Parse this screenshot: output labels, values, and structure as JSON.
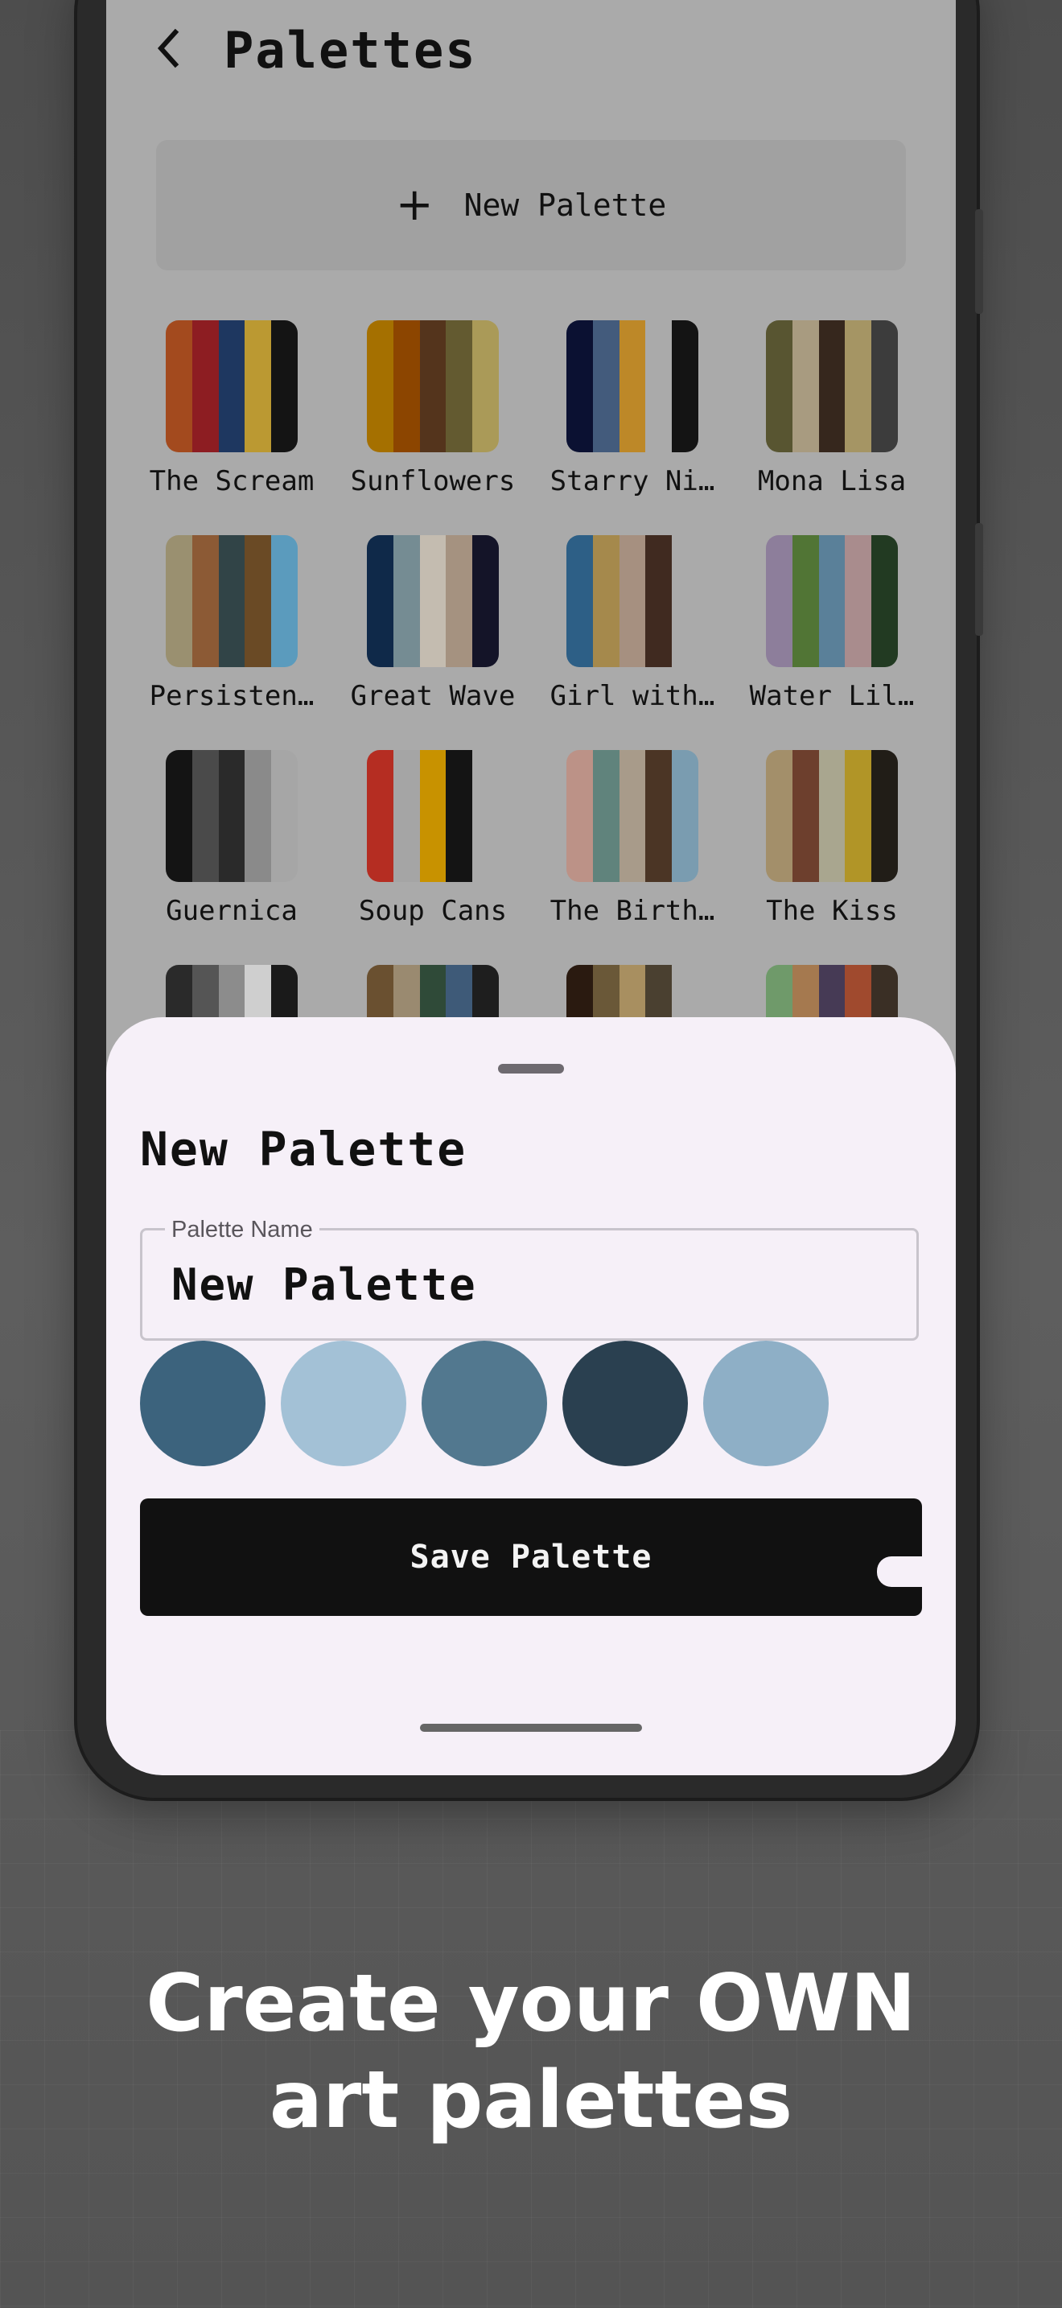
{
  "header": {
    "title": "Palettes",
    "back_icon": "arrow-back-icon"
  },
  "new_palette_button": {
    "icon": "plus-icon",
    "label": "New Palette"
  },
  "palettes": [
    {
      "name": "The Scream",
      "colors": [
        "#a34a1e",
        "#8d1d22",
        "#1e3760",
        "#bb9932",
        "#141414"
      ]
    },
    {
      "name": "Sunflowers",
      "colors": [
        "#a57000",
        "#8c4500",
        "#54341c",
        "#635a30",
        "#aa9a58"
      ]
    },
    {
      "name": "Starry Ni…",
      "colors": [
        "#0b1132",
        "#435b7c",
        "#bd8828",
        "#aaaaaa",
        "#141414"
      ]
    },
    {
      "name": "Mona Lisa",
      "colors": [
        "#585531",
        "#a89b80",
        "#36271d",
        "#a59564",
        "#3c3c3c"
      ]
    },
    {
      "name": "Persisten…",
      "colors": [
        "#9a9070",
        "#8c5a35",
        "#314447",
        "#6a4a25",
        "#5b9bbd"
      ]
    },
    {
      "name": "Great Wave",
      "colors": [
        "#0f2949",
        "#758c93",
        "#c4bcb0",
        "#a59280",
        "#141428"
      ]
    },
    {
      "name": "Girl with…",
      "colors": [
        "#2d5f86",
        "#a5894c",
        "#a69080",
        "#402a20",
        "#aaaaaa"
      ]
    },
    {
      "name": "Water Lil…",
      "colors": [
        "#8d7e9b",
        "#517535",
        "#5a8099",
        "#a98c8d",
        "#223a22"
      ]
    },
    {
      "name": "Guernica",
      "colors": [
        "#141414",
        "#4a4a4a",
        "#2a2a2a",
        "#8a8a8a",
        "#a6a6a6"
      ]
    },
    {
      "name": "Soup Cans",
      "colors": [
        "#b52d22",
        "#a5a5a5",
        "#c89200",
        "#141414",
        "#aaaaaa"
      ]
    },
    {
      "name": "The Birth…",
      "colors": [
        "#bc9287",
        "#60837c",
        "#a89b8a",
        "#4b3525",
        "#7a9cb0"
      ]
    },
    {
      "name": "The Kiss",
      "colors": [
        "#a38f6a",
        "#6d3f2d",
        "#a9a68f",
        "#b19527",
        "#211d17"
      ]
    },
    {
      "name": "",
      "colors": [
        "#2a2a2a",
        "#555555",
        "#8c8c8c",
        "#cfcfcf",
        "#1a1a1a"
      ]
    },
    {
      "name": "",
      "colors": [
        "#6a5030",
        "#9a8a70",
        "#2f4a38",
        "#3e5a78",
        "#1e1e1e"
      ]
    },
    {
      "name": "",
      "colors": [
        "#2a1a10",
        "#6a5838",
        "#a88f60",
        "#4a4030",
        "#aaaaaa"
      ]
    },
    {
      "name": "",
      "colors": [
        "#6f9a6a",
        "#a5794f",
        "#463a55",
        "#a04a2e",
        "#3a2f25"
      ]
    }
  ],
  "sheet": {
    "title": "New Palette",
    "name_field": {
      "label": "Palette Name",
      "value": "New Palette"
    },
    "colors": [
      "#3c637d",
      "#a3c1d6",
      "#52788f",
      "#2a4050",
      "#8eafc6"
    ],
    "save_label": "Save Palette"
  },
  "tagline": {
    "line1": "Create your OWN",
    "line2": "art palettes"
  }
}
